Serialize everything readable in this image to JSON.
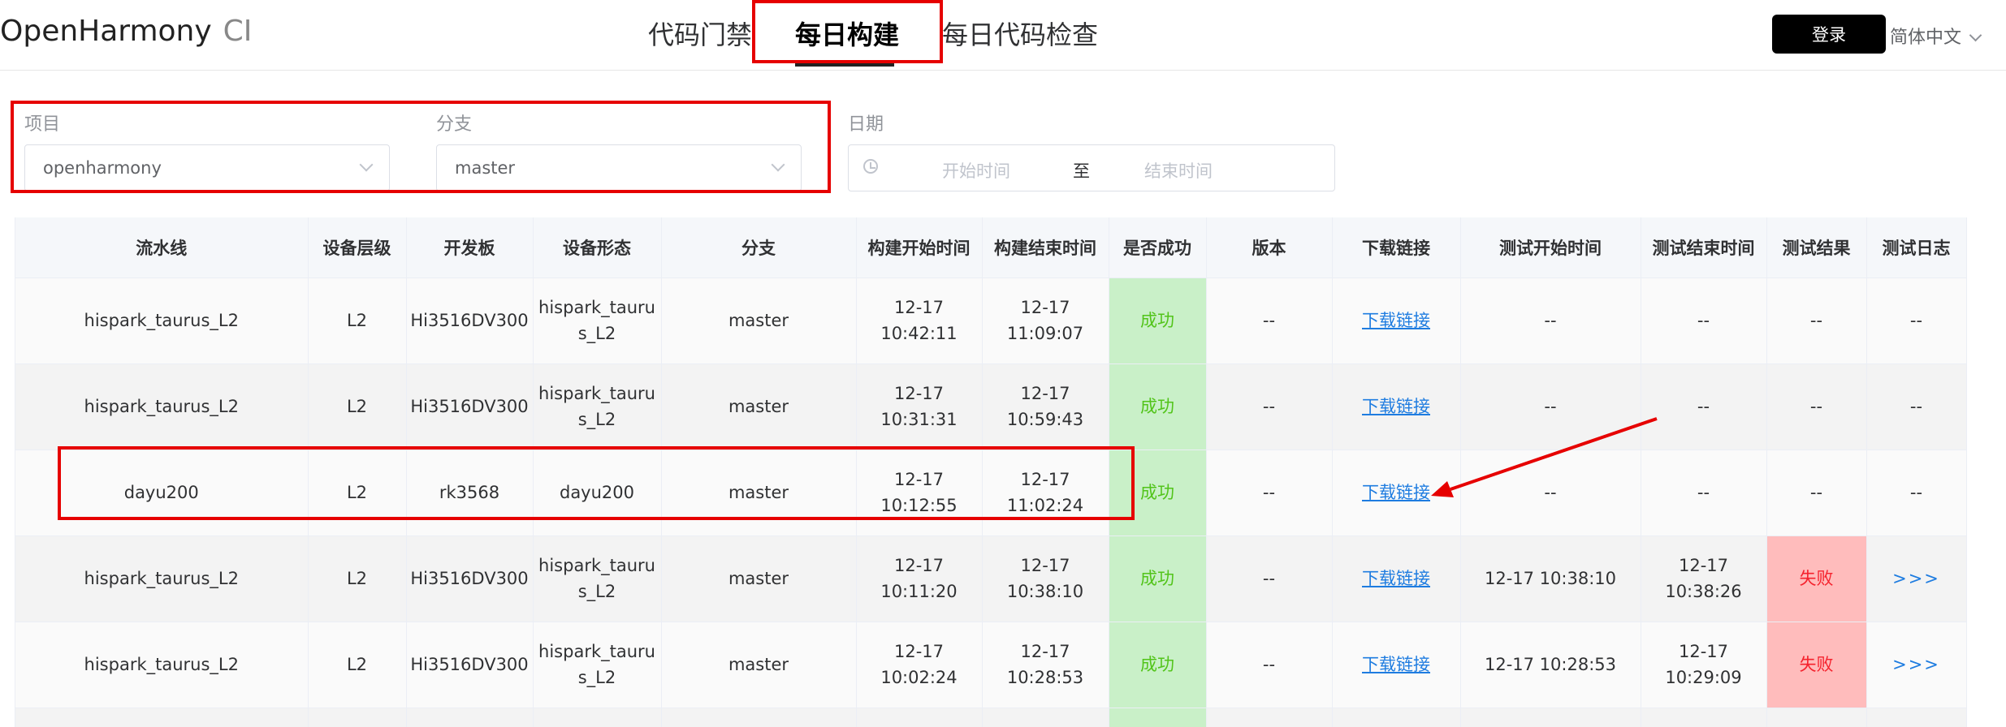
{
  "header": {
    "brand": "OpenHarmony",
    "brand_suffix": "CI",
    "nav": [
      "代码门禁",
      "每日构建",
      "每日代码检查"
    ],
    "login_label": "登录",
    "language": "简体中文"
  },
  "filters": {
    "project_label": "项目",
    "project_value": "openharmony",
    "branch_label": "分支",
    "branch_value": "master",
    "date_label": "日期",
    "start_placeholder": "开始时间",
    "range_separator": "至",
    "end_placeholder": "结束时间"
  },
  "table": {
    "columns": [
      "流水线",
      "设备层级",
      "开发板",
      "设备形态",
      "分支",
      "构建开始时间",
      "构建结束时间",
      "是否成功",
      "版本",
      "下载链接",
      "测试开始时间",
      "测试结束时间",
      "测试结果",
      "测试日志"
    ],
    "rows": [
      [
        "hispark_taurus_L2",
        "L2",
        "Hi3516DV300",
        "hispark_taurus_L2",
        "master",
        "12-17 10:42:11",
        "12-17 11:09:07",
        "成功",
        "--",
        "下载链接",
        "--",
        "--",
        "--",
        "--"
      ],
      [
        "hispark_taurus_L2",
        "L2",
        "Hi3516DV300",
        "hispark_taurus_L2",
        "master",
        "12-17 10:31:31",
        "12-17 10:59:43",
        "成功",
        "--",
        "下载链接",
        "--",
        "--",
        "--",
        "--"
      ],
      [
        "dayu200",
        "L2",
        "rk3568",
        "dayu200",
        "master",
        "12-17 10:12:55",
        "12-17 11:02:24",
        "成功",
        "--",
        "下载链接",
        "--",
        "--",
        "--",
        "--"
      ],
      [
        "hispark_taurus_L2",
        "L2",
        "Hi3516DV300",
        "hispark_taurus_L2",
        "master",
        "12-17 10:11:20",
        "12-17 10:38:10",
        "成功",
        "--",
        "下载链接",
        "12-17 10:38:10",
        "12-17 10:38:26",
        "失败",
        ">>>"
      ],
      [
        "hispark_taurus_L2",
        "L2",
        "Hi3516DV300",
        "hispark_taurus_L2",
        "master",
        "12-17 10:02:24",
        "12-17 10:28:53",
        "成功",
        "--",
        "下载链接",
        "12-17 10:28:53",
        "12-17 10:29:09",
        "失败",
        ">>>"
      ]
    ]
  },
  "annotation_color": "#e60000",
  "colors": {
    "success_bg": "#c9f0c8",
    "fail_bg": "#ffbcbc",
    "link": "#1e7ce0"
  }
}
